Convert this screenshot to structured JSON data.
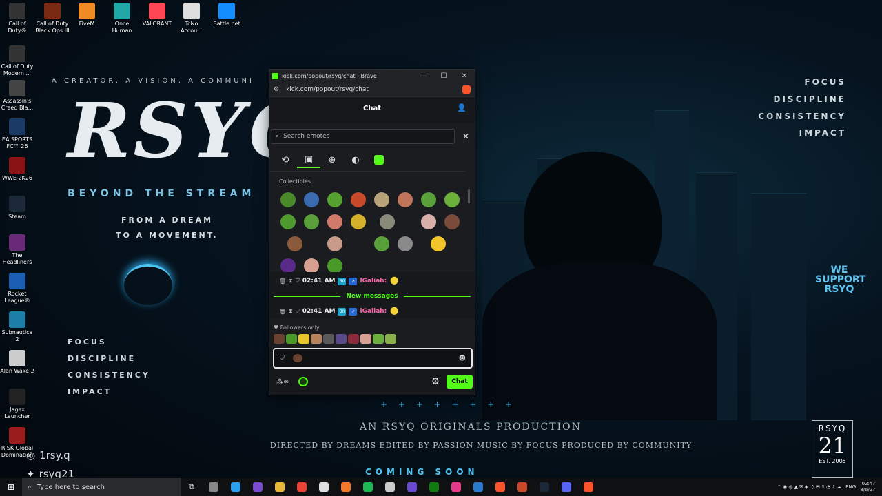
{
  "desktop_icons": [
    {
      "label": "Call of Duty®",
      "color": "#333"
    },
    {
      "label": "Call of Duty Black Ops III",
      "color": "#7a2a12"
    },
    {
      "label": "FiveM",
      "color": "#f08a24"
    },
    {
      "label": "Once Human",
      "color": "#23a8a8"
    },
    {
      "label": "VALORANT",
      "color": "#ff4655"
    },
    {
      "label": "TcNo Accou...",
      "color": "#ddd"
    },
    {
      "label": "Battle.net",
      "color": "#148eff"
    },
    {
      "label": "Call of Duty Modern ...",
      "color": "#333"
    },
    {
      "label": "Assassin's Creed Bla...",
      "color": "#444"
    },
    {
      "label": "EA SPORTS FC™ 26",
      "color": "#1c3a66"
    },
    {
      "label": "WWE 2K26",
      "color": "#8a1313"
    },
    {
      "label": "Steam",
      "color": "#1b2838"
    },
    {
      "label": "The Headliners",
      "color": "#6a2a7a"
    },
    {
      "label": "Rocket League®",
      "color": "#1a5fb4"
    },
    {
      "label": "Subnautica 2",
      "color": "#1d7fa8"
    },
    {
      "label": "Alan Wake 2",
      "color": "#ccc"
    },
    {
      "label": "Jagex Launcher",
      "color": "#222"
    },
    {
      "label": "RISK Global Domination",
      "color": "#9a1c1c"
    }
  ],
  "poster": {
    "tagline": "A CREATOR. A VISION. A COMMUNI",
    "logo": "RSYQ",
    "subtitle": "BEYOND THE STREAM",
    "line1": "FROM A DREAM",
    "line2": "TO A MOVEMENT.",
    "left_words": [
      "FOCUS",
      "DISCIPLINE",
      "CONSISTENCY",
      "IMPACT"
    ],
    "right_words": [
      "FOCUS",
      "DISCIPLINE",
      "CONSISTENCY",
      "IMPACT"
    ],
    "support": "WE SUPPORT RSYQ",
    "plus_row": "+ + + + + + + +",
    "production": "AN RSYQ ORIGINALS PRODUCTION",
    "credits": "DIRECTED BY DREAMS  EDITED BY PASSION  MUSIC BY FOCUS  PRODUCED BY COMMUNITY",
    "coming": "COMING SOON",
    "badge_name": "RSYQ",
    "badge_num": "21",
    "badge_est": "EST. 2005",
    "instagram": "1rsy.q",
    "twitter": "rsyq21"
  },
  "browser": {
    "title": "kick.com/popout/rsyq/chat - Brave",
    "url": "kick.com/popout/rsyq/chat",
    "min": "—",
    "max": "☐",
    "close": "✕"
  },
  "chat": {
    "header": "Chat",
    "search_placeholder": "Search emotes",
    "collectibles_label": "Collectibles",
    "messages": [
      {
        "time": "02:41 AM",
        "sub": "30",
        "user": "lGaliah:"
      },
      {
        "time": "02:41 AM",
        "sub": "30",
        "user": "lGaliah:"
      }
    ],
    "new_messages": "New messages",
    "followers_only": "Followers only",
    "send_label": "Chat",
    "points": "∞"
  },
  "emotes": [
    {
      "color": "#4a8a2a"
    },
    {
      "color": "#3a6ab0"
    },
    {
      "color": "#55a02f"
    },
    {
      "color": "#c84a2a"
    },
    {
      "color": "#b8a27a"
    },
    {
      "color": "#c0755a"
    },
    {
      "color": "#5aa03a"
    },
    {
      "color": "#6ab03a"
    },
    {
      "color": "#4f9a2f"
    },
    {
      "color": "#5aa03a"
    },
    {
      "color": "#d07a6a"
    },
    {
      "color": "#d4b22a"
    },
    {
      "color": "#8a8a7a"
    },
    {
      "color": "#d8b0a8"
    },
    {
      "color": "#7a4a3a"
    },
    {
      "color": "#8a5a3a"
    },
    {
      "color": "#c89a8a"
    },
    {
      "color": "#5aa03a"
    },
    {
      "color": "#8a8a8a"
    },
    {
      "color": "#f2c62a"
    },
    {
      "color": "#5a2a8a"
    },
    {
      "color": "#d8a090"
    },
    {
      "color": "#4a9a2a"
    }
  ],
  "quick_emotes": [
    {
      "color": "#6b4232"
    },
    {
      "color": "#4a9a2a"
    },
    {
      "color": "#e8c52a"
    },
    {
      "color": "#b8825a"
    },
    {
      "color": "#5a5a5a"
    },
    {
      "color": "#5a4a8a"
    },
    {
      "color": "#8a2a3a"
    },
    {
      "color": "#d8a090"
    },
    {
      "color": "#6ab03a"
    },
    {
      "color": "#8ab04a"
    }
  ],
  "taskbar": {
    "search_placeholder": "Type here to search",
    "apps": [
      {
        "color": "#888"
      },
      {
        "color": "#2aa0f0"
      },
      {
        "color": "#7a4ad0"
      },
      {
        "color": "#e8b83a"
      },
      {
        "color": "#ea4335"
      },
      {
        "color": "#ddd"
      },
      {
        "color": "#f07a2a"
      },
      {
        "color": "#1db954"
      },
      {
        "color": "#cccccc"
      },
      {
        "color": "#6a4ad0"
      },
      {
        "color": "#107c10"
      },
      {
        "color": "#e83a8a"
      },
      {
        "color": "#2a7ad0"
      },
      {
        "color": "#fb542b"
      },
      {
        "color": "#c84a2a"
      },
      {
        "color": "#1b2838"
      },
      {
        "color": "#5865f2"
      },
      {
        "color": "#fb542b"
      }
    ],
    "language": "ENG",
    "time": "02:4?",
    "date": "8/6/2?"
  }
}
